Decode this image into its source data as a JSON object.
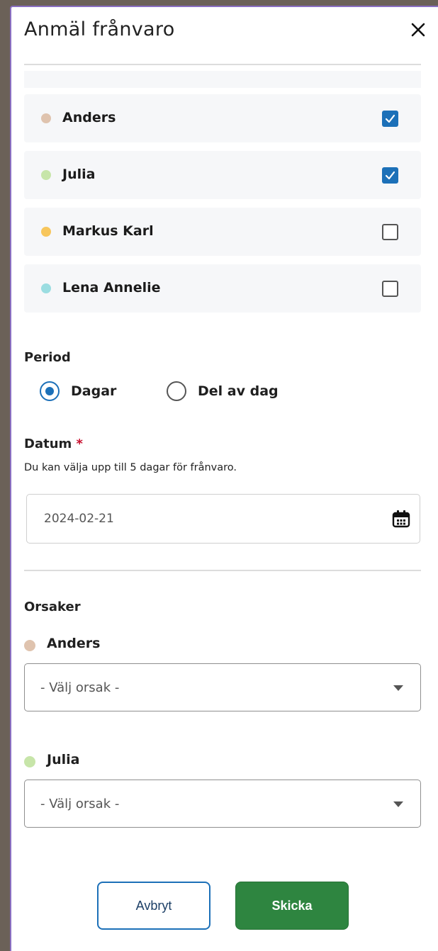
{
  "colors": {
    "accent": "#1c70b8",
    "submit": "#2e8540",
    "required": "#c8102e"
  },
  "header": {
    "title": "Anmäl frånvaro",
    "close_icon": "close-icon"
  },
  "children": [
    {
      "name": "Anders",
      "dot_color": "#dfc3ae",
      "checked": true
    },
    {
      "name": "Julia",
      "dot_color": "#c7e5a9",
      "checked": true
    },
    {
      "name": "Markus Karl",
      "dot_color": "#f7c65c",
      "checked": false
    },
    {
      "name": "Lena Annelie",
      "dot_color": "#9bdde1",
      "checked": false
    }
  ],
  "period": {
    "label": "Period",
    "options": [
      {
        "label": "Dagar",
        "selected": true
      },
      {
        "label": "Del av dag",
        "selected": false
      }
    ]
  },
  "date": {
    "label": "Datum",
    "required_mark": "*",
    "hint": "Du kan välja upp till 5 dagar för frånvaro.",
    "value": "2024-02-21",
    "icon": "calendar-icon"
  },
  "reasons": {
    "label": "Orsaker",
    "items": [
      {
        "child": "Anders",
        "dot_color": "#dfc3ae",
        "placeholder": "- Välj orsak -"
      },
      {
        "child": "Julia",
        "dot_color": "#c7e5a9",
        "placeholder": "- Välj orsak -"
      }
    ]
  },
  "buttons": {
    "cancel": "Avbryt",
    "submit": "Skicka"
  }
}
